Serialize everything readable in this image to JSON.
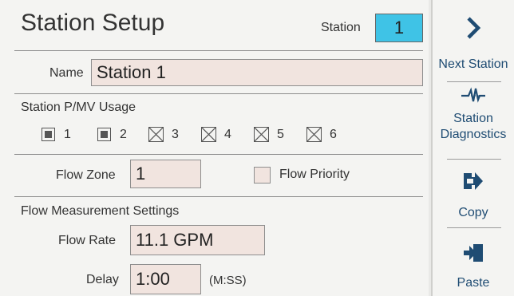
{
  "header": {
    "title": "Station Setup",
    "station_label": "Station",
    "station_number": "1"
  },
  "name": {
    "label": "Name",
    "value": "Station 1"
  },
  "pmv": {
    "heading": "Station P/MV Usage",
    "items": [
      {
        "label": "1",
        "checked": true
      },
      {
        "label": "2",
        "checked": true
      },
      {
        "label": "3",
        "checked": false
      },
      {
        "label": "4",
        "checked": false
      },
      {
        "label": "5",
        "checked": false
      },
      {
        "label": "6",
        "checked": false
      }
    ]
  },
  "flow_zone": {
    "label": "Flow Zone",
    "value": "1"
  },
  "flow_priority": {
    "label": "Flow Priority",
    "checked": false
  },
  "measurement": {
    "heading": "Flow Measurement Settings",
    "rate_label": "Flow Rate",
    "rate_value": "11.1 GPM",
    "delay_label": "Delay",
    "delay_value": "1:00",
    "delay_unit": "(M:SS)"
  },
  "sidebar": {
    "next": {
      "label": "Next Station",
      "icon": "chevron-right-icon"
    },
    "diagnostics": {
      "label_line1": "Station",
      "label_line2": "Diagnostics",
      "icon": "waveform-icon"
    },
    "copy": {
      "label": "Copy",
      "icon": "copy-arrow-icon"
    },
    "paste": {
      "label": "Paste",
      "icon": "paste-arrow-icon"
    }
  },
  "colors": {
    "accent": "#3fc3e6",
    "field_bg": "#f1e4df",
    "button_text": "#1f4c73"
  }
}
